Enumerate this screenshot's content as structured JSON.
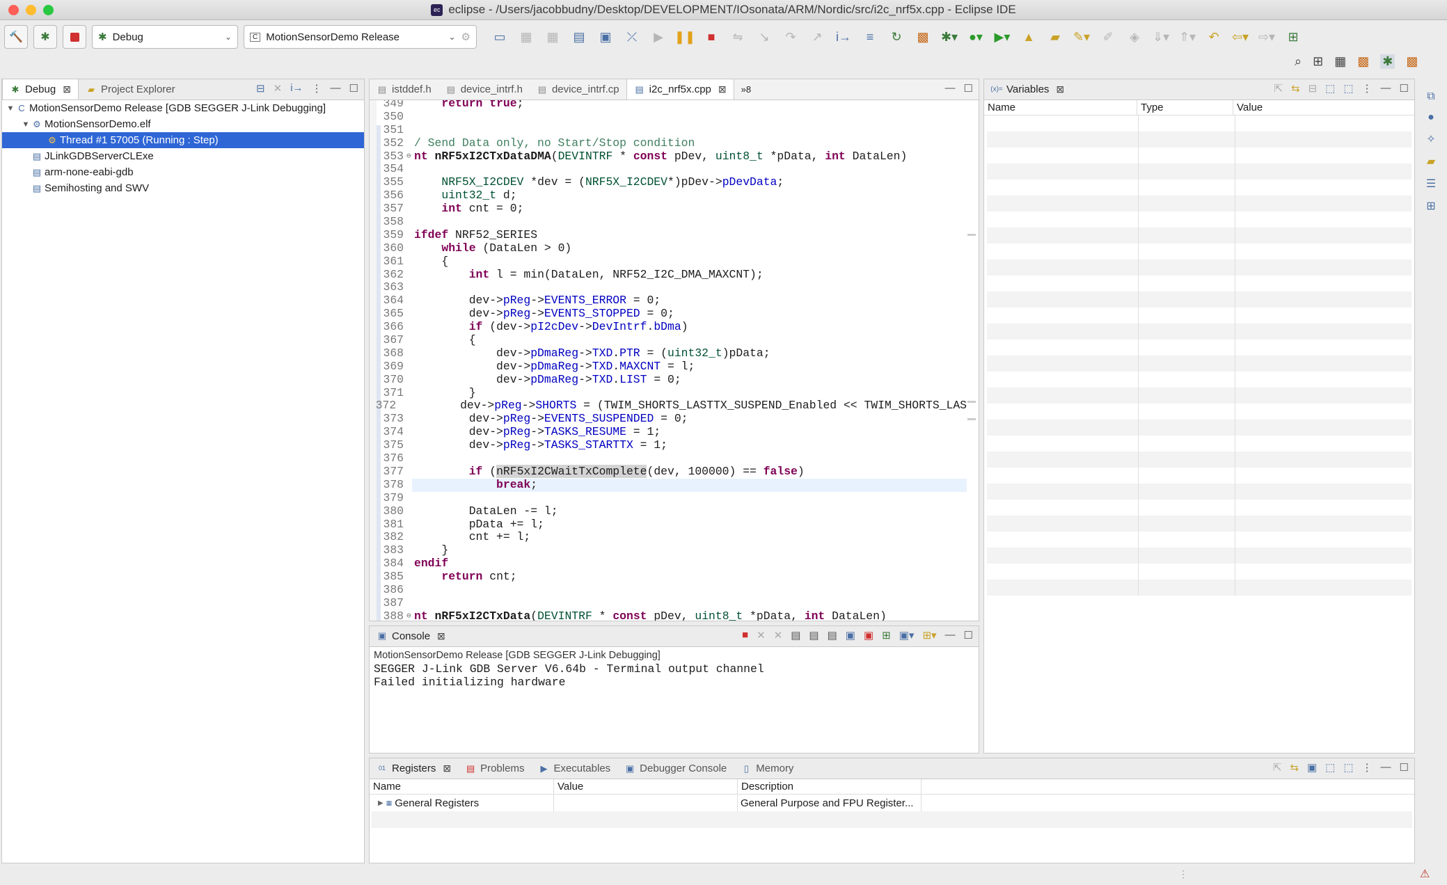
{
  "window": {
    "title": "eclipse - /Users/jacobbudny/Desktop/DEVELOPMENT/IOsonata/ARM/Nordic/src/i2c_nrf5x.cpp - Eclipse IDE",
    "app_icon_text": "ec",
    "traffic_colors": [
      "#fe5f57",
      "#febc2e",
      "#28c840"
    ]
  },
  "toolbar": {
    "launch_mode": "Debug",
    "launch_config": "MotionSensorDemo Release",
    "config_icon_text": "C"
  },
  "debug_view": {
    "tabs": [
      {
        "label": "Debug",
        "icon": "bug-icon"
      },
      {
        "label": "Project Explorer",
        "icon": "folder-icon"
      }
    ],
    "tree": [
      {
        "label": "MotionSensorDemo Release [GDB SEGGER J-Link Debugging]",
        "depth": 0,
        "twisty": "▼",
        "icon": "C"
      },
      {
        "label": "MotionSensorDemo.elf",
        "depth": 1,
        "twisty": "▼",
        "icon": "⚙"
      },
      {
        "label": "Thread #1 57005 (Running : Step)",
        "depth": 2,
        "twisty": "",
        "icon": "⚙",
        "selected": true
      },
      {
        "label": "JLinkGDBServerCLExe",
        "depth": 1,
        "twisty": "",
        "icon": "▤"
      },
      {
        "label": "arm-none-eabi-gdb",
        "depth": 1,
        "twisty": "",
        "icon": "▤"
      },
      {
        "label": "Semihosting and SWV",
        "depth": 1,
        "twisty": "",
        "icon": "▤"
      }
    ]
  },
  "editor": {
    "tabs": [
      {
        "label": "istddef.h",
        "active": false
      },
      {
        "label": "device_intrf.h",
        "active": false
      },
      {
        "label": "device_intrf.cp",
        "active": false
      },
      {
        "label": "i2c_nrf5x.cpp",
        "active": true
      }
    ],
    "overflow_label": "»8",
    "lines": [
      {
        "n": "349",
        "h": "    <span class=\"kw\">return</span> <span class=\"kw\">true</span>;"
      },
      {
        "n": "350",
        "h": ""
      },
      {
        "n": "351",
        "h": ""
      },
      {
        "n": "352",
        "h": "<span class=\"cm\">/ Send Data only, no Start/Stop condition</span>"
      },
      {
        "n": "353",
        "f": "⊖",
        "h": "<span class=\"kw\">nt</span> <b>nRF5xI2CTxDataDMA</b>(<span class=\"typ\">DEVINTRF</span> * <span class=\"kw\">const</span> pDev, <span class=\"typ\">uint8_t</span> *pData, <span class=\"kw\">int</span> DataLen)"
      },
      {
        "n": "354",
        "h": ""
      },
      {
        "n": "355",
        "h": "    <span class=\"typ\">NRF5X_I2CDEV</span> *dev = (<span class=\"typ\">NRF5X_I2CDEV</span>*)pDev-&gt;<span class=\"fld\">pDevData</span>;"
      },
      {
        "n": "356",
        "h": "    <span class=\"typ\">uint32_t</span> d;"
      },
      {
        "n": "357",
        "h": "    <span class=\"kw\">int</span> cnt = 0;"
      },
      {
        "n": "358",
        "h": ""
      },
      {
        "n": "359",
        "h": "<span class=\"kw\">ifdef</span> NRF52_SERIES"
      },
      {
        "n": "360",
        "h": "    <span class=\"kw\">while</span> (DataLen &gt; 0)"
      },
      {
        "n": "361",
        "h": "    {"
      },
      {
        "n": "362",
        "h": "        <span class=\"kw\">int</span> l = min(DataLen, NRF52_I2C_DMA_MAXCNT);"
      },
      {
        "n": "363",
        "h": ""
      },
      {
        "n": "364",
        "h": "        dev-&gt;<span class=\"fld\">pReg</span>-&gt;<span class=\"fld\">EVENTS_ERROR</span> = 0;"
      },
      {
        "n": "365",
        "h": "        dev-&gt;<span class=\"fld\">pReg</span>-&gt;<span class=\"fld\">EVENTS_STOPPED</span> = 0;"
      },
      {
        "n": "366",
        "h": "        <span class=\"kw\">if</span> (dev-&gt;<span class=\"fld\">pI2cDev</span>-&gt;<span class=\"fld\">DevIntrf</span>.<span class=\"fld\">bDma</span>)"
      },
      {
        "n": "367",
        "h": "        {"
      },
      {
        "n": "368",
        "h": "            dev-&gt;<span class=\"fld\">pDmaReg</span>-&gt;<span class=\"fld\">TXD</span>.<span class=\"fld\">PTR</span> = (<span class=\"typ\">uint32_t</span>)pData;"
      },
      {
        "n": "369",
        "h": "            dev-&gt;<span class=\"fld\">pDmaReg</span>-&gt;<span class=\"fld\">TXD</span>.<span class=\"fld\">MAXCNT</span> = l;"
      },
      {
        "n": "370",
        "h": "            dev-&gt;<span class=\"fld\">pDmaReg</span>-&gt;<span class=\"fld\">TXD</span>.<span class=\"fld\">LIST</span> = 0;"
      },
      {
        "n": "371",
        "h": "        }"
      },
      {
        "n": "372",
        "h": "        dev-&gt;<span class=\"fld\">pReg</span>-&gt;<span class=\"fld\">SHORTS</span> = (TWIM_SHORTS_LASTTX_SUSPEND_Enabled &lt;&lt; TWIM_SHORTS_LAS"
      },
      {
        "n": "373",
        "h": "        dev-&gt;<span class=\"fld\">pReg</span>-&gt;<span class=\"fld\">EVENTS_SUSPENDED</span> = 0;"
      },
      {
        "n": "374",
        "h": "        dev-&gt;<span class=\"fld\">pReg</span>-&gt;<span class=\"fld\">TASKS_RESUME</span> = 1;"
      },
      {
        "n": "375",
        "h": "        dev-&gt;<span class=\"fld\">pReg</span>-&gt;<span class=\"fld\">TASKS_STARTTX</span> = 1;"
      },
      {
        "n": "376",
        "h": ""
      },
      {
        "n": "377",
        "h": "        <span class=\"kw\">if</span> (<span class=\"hlword\">nRF5xI2CWaitTxComplete</span>(dev, 100000) == <span class=\"kw\">false</span>)"
      },
      {
        "n": "378",
        "hl": true,
        "h": "            <span class=\"kw\">break</span>;"
      },
      {
        "n": "379",
        "h": ""
      },
      {
        "n": "380",
        "h": "        DataLen -= l;"
      },
      {
        "n": "381",
        "h": "        pData += l;"
      },
      {
        "n": "382",
        "h": "        cnt += l;"
      },
      {
        "n": "383",
        "h": "    }"
      },
      {
        "n": "384",
        "h": "<span class=\"kw\">endif</span>"
      },
      {
        "n": "385",
        "h": "    <span class=\"kw\">return</span> cnt;"
      },
      {
        "n": "386",
        "h": ""
      },
      {
        "n": "387",
        "h": ""
      },
      {
        "n": "388",
        "f": "⊖",
        "h": "<span class=\"kw\">nt</span> <b>nRF5xI2CTxData</b>(<span class=\"typ\">DEVINTRF</span> * <span class=\"kw\">const</span> pDev, <span class=\"typ\">uint8_t</span> *pData, <span class=\"kw\">int</span> DataLen)"
      }
    ]
  },
  "variables_view": {
    "tab": "Variables",
    "tab_icon_text": "(x)=",
    "columns": [
      "Name",
      "Type",
      "Value"
    ]
  },
  "console_view": {
    "tab": "Console",
    "launch_label": "MotionSensorDemo Release [GDB SEGGER J-Link Debugging]",
    "output": [
      "SEGGER J-Link GDB Server V6.64b - Terminal output channel",
      "Failed initializing hardware"
    ]
  },
  "registers_view": {
    "tabs": [
      "Registers",
      "Problems",
      "Executables",
      "Debugger Console",
      "Memory"
    ],
    "columns": [
      "Name",
      "Value",
      "Description"
    ],
    "rows": [
      {
        "name": "General Registers",
        "value": "",
        "description": "General Purpose and FPU Register..."
      }
    ]
  }
}
